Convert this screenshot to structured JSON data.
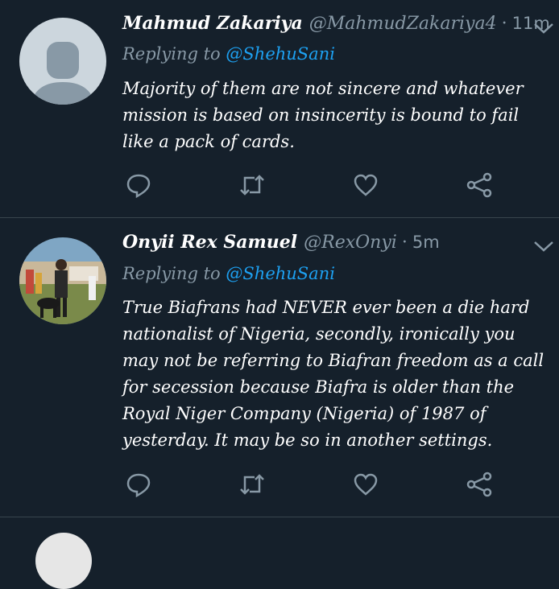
{
  "tweets": [
    {
      "name": "Mahmud Zakariya",
      "handle": "@MahmudZakariya4",
      "time": "11m",
      "replying_prefix": "Replying to",
      "replying_to": "@ShehuSani",
      "text": "Majority of them are not sincere and whatever mission is based on insincerity is bound to fail like a pack of cards."
    },
    {
      "name": "Onyii Rex Samuel",
      "handle": "@RexOnyi",
      "time": "5m",
      "replying_prefix": "Replying to",
      "replying_to": "@ShehuSani",
      "text": "True Biafrans had NEVER ever been a die hard nationalist of Nigeria, secondly, ironically you may not be referring to Biafran freedom as a call for secession because Biafra is older than the Royal Niger Company (Nigeria) of 1987 of yesterday. It may be so in another settings."
    }
  ],
  "dot": "·",
  "colors": {
    "background": "#15202b",
    "secondary": "#8899a6",
    "accent": "#1da1f2",
    "divider": "#38444d"
  },
  "icons": [
    "chevron-down-icon",
    "reply-icon",
    "retweet-icon",
    "like-icon",
    "share-icon"
  ]
}
